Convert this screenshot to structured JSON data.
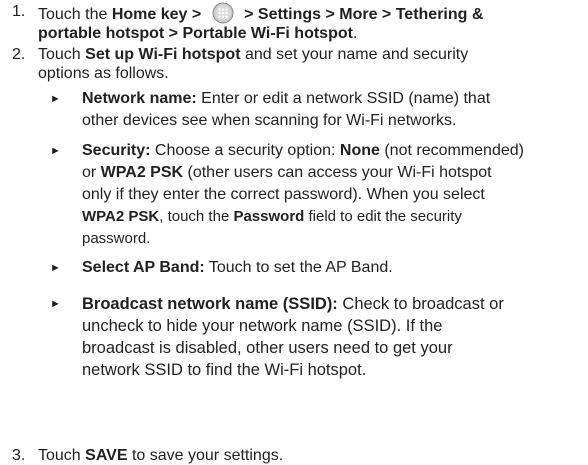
{
  "steps": [
    {
      "num": "1.",
      "pre": "Touch the ",
      "home": "Home",
      "key_gt": " key > ",
      "icon": "apps-grid-icon",
      "path_a": " > Settings > More > Tethering &",
      "path_b": "portable hotspot > Portable Wi-Fi hotspot",
      "end": "."
    },
    {
      "num": "2.",
      "pre": "Touch ",
      "bold": "Set up Wi-Fi hotspot",
      "post_a": " and set your name and security",
      "post_b": "options as follows."
    },
    {
      "num": "3.",
      "pre": "Touch ",
      "bold": "SAVE",
      "post": " to save your settings."
    }
  ],
  "bullets": {
    "marker": "►",
    "network": {
      "label": "Network name:",
      "l1": " Enter or edit a network SSID (name) that",
      "l2": "other devices see when scanning for Wi-Fi networks."
    },
    "security": {
      "label": "Security:",
      "l1a": " Choose a security option: ",
      "none": "None",
      "l1b": " (not recommended)",
      "l2a": "or ",
      "wpa": "WPA2 PSK",
      "l2b": " (other users can access your Wi-Fi hotspot",
      "l3": "only if they enter the correct password). When you select",
      "wpa2": "WPA2 PSK",
      "l4a": ", touch the ",
      "password": "Password",
      "l4b": " field to edit the security",
      "l5": "password."
    },
    "band": {
      "label": "Select AP Band:",
      "text": " Touch to set the AP Band."
    },
    "broadcast": {
      "label": "Broadcast network name (SSID):",
      "l1": " Check to broadcast or",
      "l2": "uncheck to hide your network name (SSID). If the",
      "l3": "broadcast is disabled, other users need to get your",
      "l4": "network SSID to find the Wi-Fi hotspot."
    }
  }
}
